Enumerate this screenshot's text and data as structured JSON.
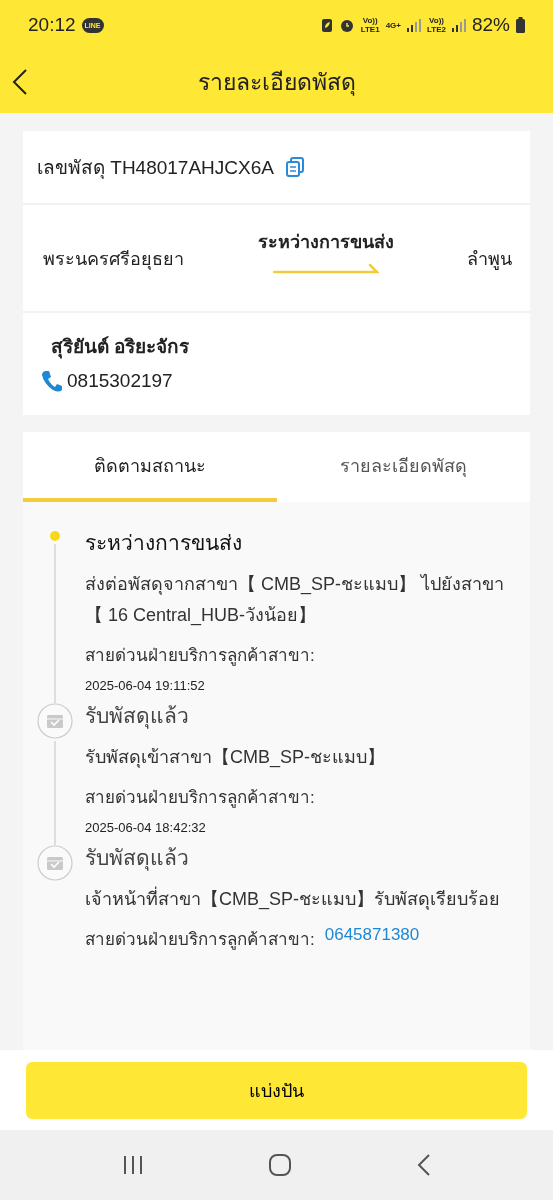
{
  "status_bar": {
    "time": "20:12",
    "app_badge": "LINE",
    "network_1": [
      "Vo))",
      "LTE1"
    ],
    "data_type": "4G+",
    "network_2": [
      "Vo))",
      "LTE2"
    ],
    "battery": "82%"
  },
  "header": {
    "title": "รายละเอียดพัสดุ"
  },
  "parcel": {
    "label": "เลขพัสดุ",
    "number": "TH48017AHJCX6A",
    "origin": "พระนครศรีอยุธยา",
    "status": "ระหว่างการขนส่ง",
    "destination": "ลำพูน",
    "recipient": "สุริยันต์ อริยะจักร",
    "phone": "0815302197"
  },
  "tabs": [
    {
      "label": "ติดตามสถานะ",
      "selected": true
    },
    {
      "label": "รายละเอียดพัสดุ",
      "selected": false
    }
  ],
  "events": [
    {
      "kind": "current",
      "title": "ระหว่างการขนส่ง",
      "detail": "ส่งต่อพัสดุจากสาขา【 CMB_SP-ชะแมบ】 ไปยังสาขา【 16 Central_HUB-วังน้อย】",
      "hotline": "สายด่วนฝ่ายบริการลูกค้าสาขา:",
      "time": "2025-06-04 19:11:52"
    },
    {
      "kind": "received",
      "title": "รับพัสดุแล้ว",
      "detail": "รับพัสดุเข้าสาขา【CMB_SP-ชะแมบ】",
      "hotline": "สายด่วนฝ่ายบริการลูกค้าสาขา:",
      "time": "2025-06-04 18:42:32"
    },
    {
      "kind": "received",
      "title": "รับพัสดุแล้ว",
      "detail": "เจ้าหน้าที่สาขา【CMB_SP-ชะแมบ】รับพัสดุเรียบร้อย",
      "hotline": "สายด่วนฝ่ายบริการลูกค้าสาขา:",
      "hotline_phone": "0645871380"
    }
  ],
  "action_button": "แบ่งปัน"
}
